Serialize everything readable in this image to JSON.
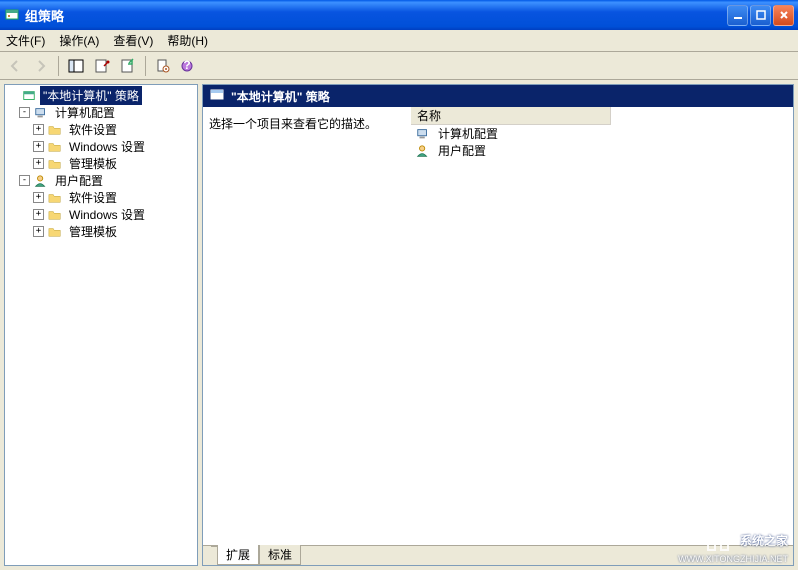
{
  "window": {
    "title": "组策略"
  },
  "menu": {
    "file": "文件(F)",
    "action": "操作(A)",
    "view": "查看(V)",
    "help": "帮助(H)"
  },
  "tree": {
    "root": "\"本地计算机\" 策略",
    "computer": "计算机配置",
    "software1": "软件设置",
    "windows1": "Windows 设置",
    "templates1": "管理模板",
    "user": "用户配置",
    "software2": "软件设置",
    "windows2": "Windows 设置",
    "templates2": "管理模板"
  },
  "content": {
    "header": "\"本地计算机\" 策略",
    "description": "选择一个项目来查看它的描述。",
    "column_name": "名称",
    "item_computer": "计算机配置",
    "item_user": "用户配置"
  },
  "tabs": {
    "extended": "扩展",
    "standard": "标准"
  },
  "watermark": {
    "main": "系统之家",
    "sub": "WWW.XITONGZHIJIA.NET"
  }
}
